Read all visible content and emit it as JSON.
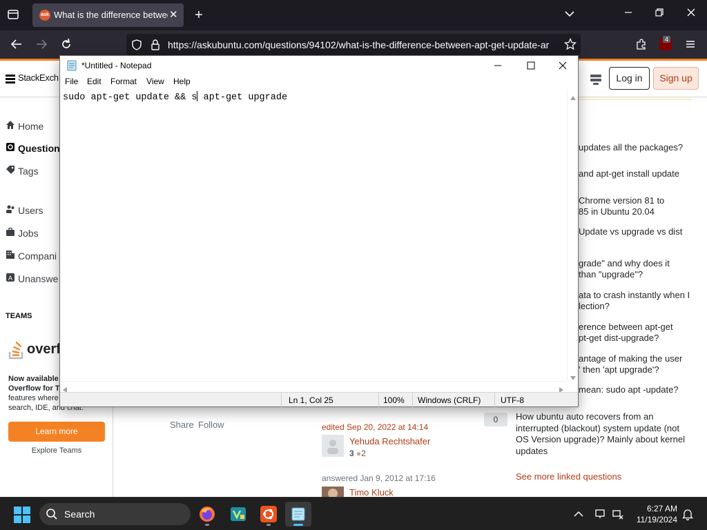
{
  "browser": {
    "tab_title": "What is the difference between",
    "tab_favicon_text": "ask",
    "url": "https://askubuntu.com/questions/94102/what-is-the-difference-between-apt-get-update-ar",
    "extension_badge": "4"
  },
  "stackexchange": {
    "logo_text": "StackExch",
    "login_label": "Log in",
    "signup_label": "Sign up",
    "nav": [
      {
        "label": "Home",
        "icon": "home-icon"
      },
      {
        "label": "Question",
        "icon": "questions-icon"
      },
      {
        "label": "Tags",
        "icon": "tag-icon"
      },
      {
        "label": "Users",
        "icon": "users-icon"
      },
      {
        "label": "Jobs",
        "icon": "briefcase-icon"
      },
      {
        "label": "Compani",
        "icon": "building-icon"
      },
      {
        "label": "Unanswe",
        "icon": "unanswered-icon"
      }
    ],
    "teams_heading": "TEAMS",
    "teams_logo_text": "overfl",
    "teams_promo": [
      "Now available",
      "Overflow for T",
      "features where",
      "search, IDE, and chat."
    ],
    "learn_more_label": "Learn more",
    "explore_teams_label": "Explore Teams",
    "share_label": "Share",
    "follow_label": "Follow",
    "edited_text": "edited Sep 20, 2022 at 14:14",
    "editor_name": "Yehuda Rechtshafer",
    "editor_rep": "3",
    "editor_bronze": "2",
    "answered_text": "answered Jan 9, 2012 at 17:16",
    "answerer_name": "Timo Kluck",
    "linked_questions": [
      [
        "updates all the packages?"
      ],
      [
        "and apt-get install update"
      ],
      [
        "Chrome version 81 to",
        "85 in Ubuntu 20.04"
      ],
      [
        "Update vs upgrade vs dist"
      ],
      [
        "grade\" and why does it",
        "than \"upgrade\"?"
      ],
      [
        "ata to crash instantly when I",
        "lection?"
      ],
      [
        "erence between apt-get",
        "pt-get dist-upgrade?"
      ],
      [
        "antage of making the user",
        "' then 'apt upgrade'?"
      ],
      [
        "mean: sudo apt -update?"
      ]
    ],
    "last_linked_score": "0",
    "last_linked_question": "How ubuntu auto recovers from an interrupted (blackout) system update (not OS Version upgrade)? Mainly about kernel updates",
    "see_more_label": "See more linked questions"
  },
  "notepad": {
    "window_title": "*Untitled - Notepad",
    "menu": [
      "File",
      "Edit",
      "Format",
      "View",
      "Help"
    ],
    "content_before_cursor": "sudo apt-get update && s",
    "content_after_cursor": " apt-get upgrade",
    "status": {
      "position": "Ln 1, Col 25",
      "zoom": "100%",
      "line_ending": "Windows (CRLF)",
      "encoding": "UTF-8"
    }
  },
  "taskbar": {
    "search_placeholder": "Search",
    "time": "6:27 AM",
    "date": "11/19/2024"
  }
}
